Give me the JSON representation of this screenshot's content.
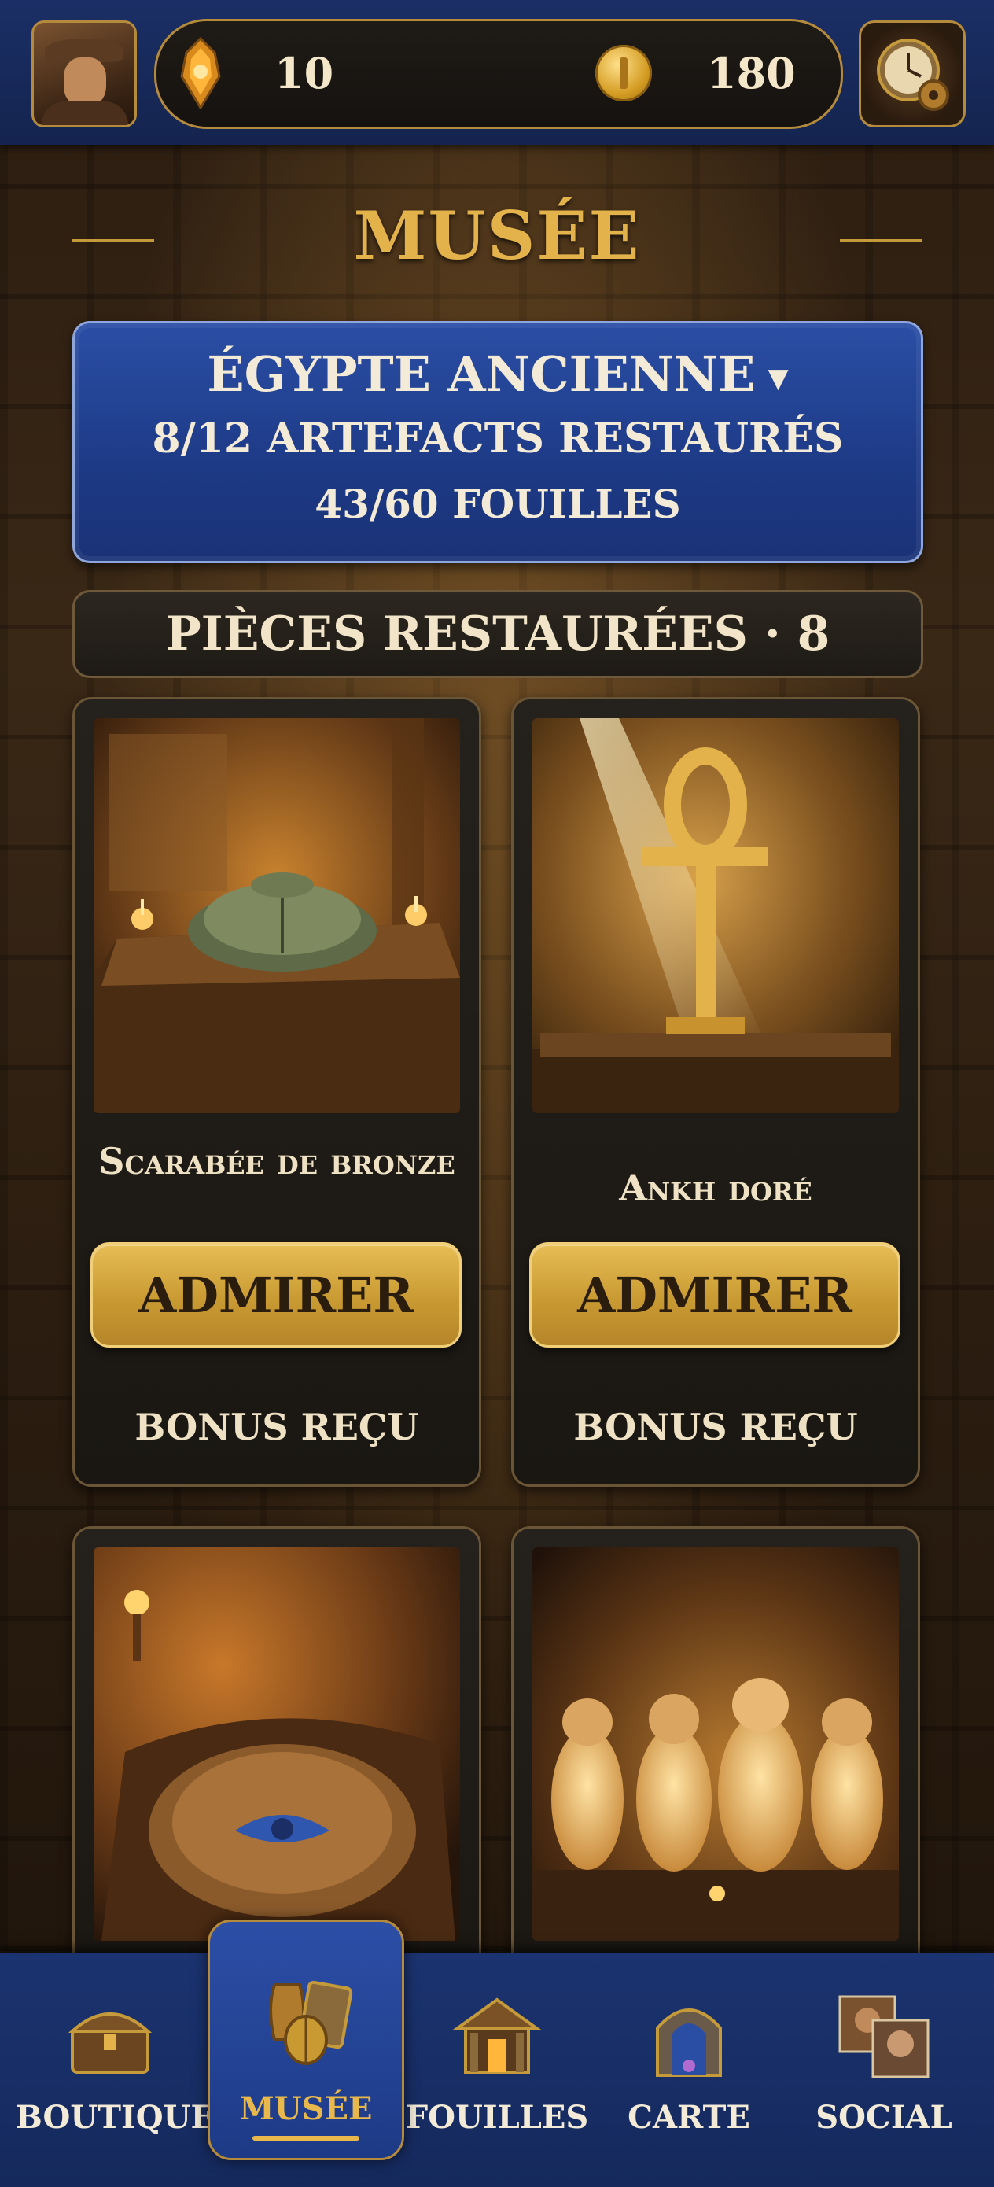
{
  "header": {
    "gems": "10",
    "coins": "180"
  },
  "page": {
    "title": "MUSÉE"
  },
  "collection": {
    "era": "ÉGYPTE ANCIENNE",
    "era_arrow": "▼",
    "artifacts": "8/12 ARTEFACTS RESTAURÉS",
    "digs": "43/60 FOUILLES"
  },
  "restored": {
    "header": "PIÈCES RESTAURÉES · 8"
  },
  "cards": [
    {
      "name": "Scarabée de bronze",
      "button": "ADMIRER",
      "bonus": "BONUS REÇU",
      "image": "bronze-scarab"
    },
    {
      "name": "Ankh doré",
      "button": "ADMIRER",
      "bonus": "BONUS REÇU",
      "image": "golden-ankh"
    },
    {
      "image": "eye-of-horus-sarcophagus"
    },
    {
      "image": "canopic-jars"
    }
  ],
  "nav": {
    "boutique": "BOUTIQUE",
    "musee": "MUSÉE",
    "fouilles": "FOUILLES",
    "carte": "CARTE",
    "social": "SOCIAL"
  },
  "colors": {
    "accent_gold": "#e3b24a",
    "panel_blue": "#1d3a86",
    "button_gold": "#c99a32"
  }
}
